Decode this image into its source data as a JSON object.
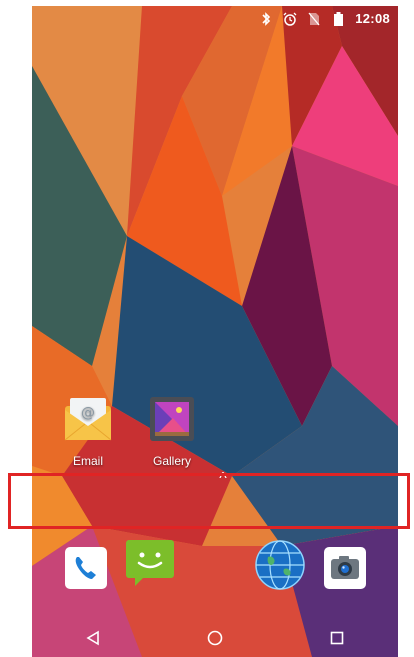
{
  "status_bar": {
    "icons": [
      "bluetooth-icon",
      "alarm-icon",
      "no-sim-icon",
      "battery-icon"
    ],
    "time": "12:08"
  },
  "home": {
    "apps": [
      {
        "label": "Email",
        "icon": "email-icon"
      },
      {
        "label": "Gallery",
        "icon": "gallery-icon"
      }
    ],
    "drawer_handle": "^"
  },
  "dock": [
    "phone-icon",
    "messaging-icon",
    "browser-globe-icon",
    "camera-icon"
  ],
  "nav_bar": [
    "back-icon",
    "home-icon",
    "recents-icon"
  ],
  "colors": {
    "highlight": "#e02424"
  }
}
